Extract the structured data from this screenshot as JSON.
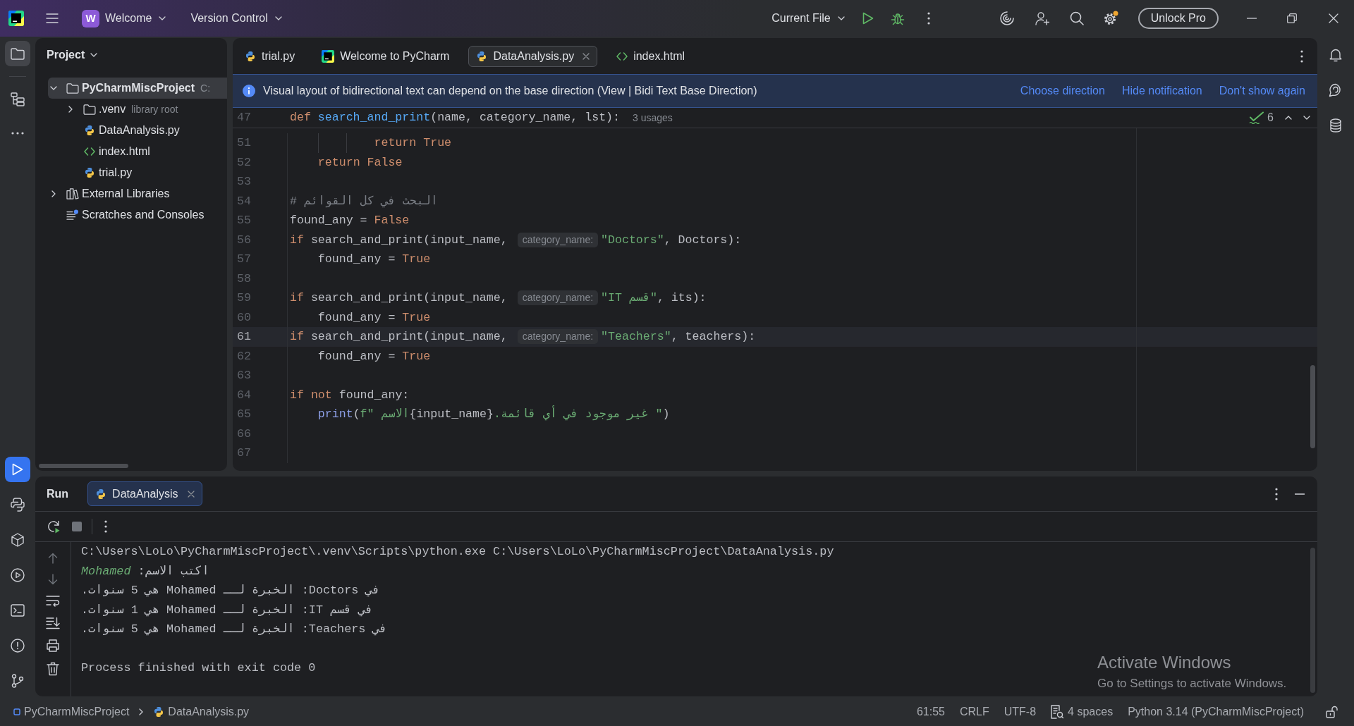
{
  "title_bar": {
    "project_badge": "W",
    "project": "Welcome",
    "vcs_menu": "Version Control",
    "run_config": "Current File",
    "unlock_button": "Unlock Pro"
  },
  "tool_strip": {
    "top": [
      {
        "selected": true
      },
      {
        "selected": false
      },
      {
        "selected": false
      }
    ],
    "bottom": [
      {
        "selected": true
      },
      {
        "selected": false
      },
      {
        "selected": false
      },
      {
        "selected": false
      },
      {
        "selected": false
      },
      {
        "selected": false
      },
      {
        "selected": false
      }
    ]
  },
  "project_panel": {
    "title": "Project",
    "tree": [
      {
        "label": "PyCharmMiscProject",
        "kind": "project",
        "hint": "C:",
        "expanded": true,
        "selected": true,
        "children": [
          {
            "label": ".venv",
            "kind": "folder",
            "hint": "library root",
            "expanded": false,
            "selected": false
          },
          {
            "label": "DataAnalysis.py",
            "kind": "python",
            "selected": false
          },
          {
            "label": "index.html",
            "kind": "html",
            "selected": false
          },
          {
            "label": "trial.py",
            "kind": "python",
            "selected": false
          }
        ]
      },
      {
        "label": "External Libraries",
        "kind": "library",
        "expanded": false,
        "selected": false
      },
      {
        "label": "Scratches and Consoles",
        "kind": "scratches",
        "selected": false
      }
    ]
  },
  "editor": {
    "tabs": [
      {
        "label": "trial.py",
        "kind": "python",
        "selected": false
      },
      {
        "label": "Welcome to PyCharm",
        "kind": "welcome",
        "selected": false
      },
      {
        "label": "DataAnalysis.py",
        "kind": "python",
        "selected": true
      },
      {
        "label": "index.html",
        "kind": "html",
        "selected": false
      }
    ],
    "notification": {
      "message": "Visual layout of bidirectional text can depend on the base direction (View | Bidi Text Base Direction)",
      "actions": [
        "Choose direction",
        "Hide notification",
        "Don't show again"
      ]
    },
    "sticky_line": {
      "number": "47",
      "tokens": [
        {
          "kind": "keyword",
          "text": "def"
        },
        {
          "kind": "function",
          "text": " search_and_print"
        },
        {
          "kind": "plain",
          "text": "(name, category_name, lst):"
        }
      ],
      "usages": "3 usages"
    },
    "problems": "6",
    "lines": [
      {
        "number": "51",
        "current": false,
        "parts": [
          {
            "kind": "code",
            "tokens": [
              {
                "kind": "keyword",
                "text": "            return True"
              }
            ]
          }
        ]
      },
      {
        "number": "52",
        "current": false,
        "parts": [
          {
            "kind": "code",
            "tokens": [
              {
                "kind": "keyword",
                "text": "    return False"
              }
            ]
          }
        ]
      },
      {
        "number": "53",
        "current": false
      },
      {
        "number": "54",
        "current": false,
        "parts": [
          {
            "kind": "code",
            "tokens": [
              {
                "kind": "comment",
                "text": "# "
              },
              {
                "kind": "comment",
                "text": "البحث في كل القوائم"
              }
            ]
          }
        ]
      },
      {
        "number": "55",
        "current": false,
        "parts": [
          {
            "kind": "code",
            "tokens": [
              {
                "kind": "plain",
                "text": "found_any = "
              },
              {
                "kind": "keyword",
                "text": "False"
              }
            ]
          }
        ]
      },
      {
        "number": "56",
        "current": false,
        "parts": [
          {
            "kind": "code",
            "tokens": [
              {
                "kind": "keyword",
                "text": "if"
              },
              {
                "kind": "plain",
                "text": " search_and_print(input_name, "
              }
            ]
          },
          {
            "kind": "hint",
            "text": "category_name:"
          },
          {
            "kind": "code",
            "tokens": [
              {
                "kind": "string",
                "text": "\"Doctors\""
              },
              {
                "kind": "plain",
                "text": ", Doctors):"
              }
            ]
          }
        ]
      },
      {
        "number": "57",
        "current": false,
        "parts": [
          {
            "kind": "code",
            "tokens": [
              {
                "kind": "plain",
                "text": "    found_any = "
              },
              {
                "kind": "keyword",
                "text": "True"
              }
            ]
          }
        ]
      },
      {
        "number": "58",
        "current": false
      },
      {
        "number": "59",
        "current": false,
        "parts": [
          {
            "kind": "code",
            "tokens": [
              {
                "kind": "keyword",
                "text": "if"
              },
              {
                "kind": "plain",
                "text": " search_and_print(input_name, "
              }
            ]
          },
          {
            "kind": "hint",
            "text": "category_name:"
          },
          {
            "kind": "code",
            "tokens": [
              {
                "kind": "string",
                "text": "\""
              },
              {
                "kind": "string",
                "text": "قسم IT"
              },
              {
                "kind": "string",
                "text": "\""
              },
              {
                "kind": "plain",
                "text": ", its):"
              }
            ]
          }
        ]
      },
      {
        "number": "60",
        "current": false,
        "parts": [
          {
            "kind": "code",
            "tokens": [
              {
                "kind": "plain",
                "text": "    found_any = "
              },
              {
                "kind": "keyword",
                "text": "True"
              }
            ]
          }
        ]
      },
      {
        "number": "61",
        "current": true,
        "parts": [
          {
            "kind": "code",
            "tokens": [
              {
                "kind": "keyword",
                "text": "if"
              },
              {
                "kind": "plain",
                "text": " search_and_print(input_name, "
              }
            ]
          },
          {
            "kind": "hint",
            "text": "category_name:"
          },
          {
            "kind": "code",
            "tokens": [
              {
                "kind": "string",
                "text": "\"Teachers\""
              },
              {
                "kind": "plain",
                "text": ", teachers):"
              }
            ]
          }
        ]
      },
      {
        "number": "62",
        "current": false,
        "parts": [
          {
            "kind": "code",
            "tokens": [
              {
                "kind": "plain",
                "text": "    found_any = "
              },
              {
                "kind": "keyword",
                "text": "True"
              }
            ]
          }
        ]
      },
      {
        "number": "63",
        "current": false
      },
      {
        "number": "64",
        "current": false,
        "parts": [
          {
            "kind": "code",
            "tokens": [
              {
                "kind": "keyword",
                "text": "if"
              },
              {
                "kind": "keyword",
                "text": " not"
              },
              {
                "kind": "plain",
                "text": " found_any:"
              }
            ]
          }
        ]
      },
      {
        "number": "65",
        "current": false,
        "parts": [
          {
            "kind": "code",
            "tokens": [
              {
                "kind": "builtin",
                "text": "    print"
              },
              {
                "kind": "plain",
                "text": "("
              },
              {
                "kind": "string",
                "text": "f\""
              },
              {
                "kind": "string",
                "text": "الاسم "
              },
              {
                "kind": "plain",
                "text": "{input_name}"
              },
              {
                "kind": "string",
                "text": " غير موجود في أي قائمة."
              },
              {
                "kind": "string",
                "text": "\""
              },
              {
                "kind": "plain",
                "text": ")"
              }
            ]
          }
        ]
      },
      {
        "number": "66",
        "current": false
      },
      {
        "number": "67",
        "current": false
      }
    ]
  },
  "run_panel": {
    "title": "Run",
    "tabs": [
      {
        "label": "DataAnalysis",
        "selected": true
      }
    ],
    "console": [
      {
        "kind": "command",
        "text": "C:\\Users\\LoLo\\PyCharmMiscProject\\.venv\\Scripts\\python.exe C:\\Users\\LoLo\\PyCharmMiscProject\\DataAnalysis.py"
      },
      {
        "kind": "prompt",
        "text": "اكتب الاسم: ",
        "input": "Mohamed"
      },
      {
        "kind": "output",
        "text": "في Doctors: الخبرة لــ Mohamed هي 5 سنوات."
      },
      {
        "kind": "output",
        "text": "في قسم IT: الخبرة لــ Mohamed هي 1 سنوات."
      },
      {
        "kind": "output",
        "text": "في Teachers: الخبرة لــ Mohamed هي 5 سنوات."
      },
      {
        "kind": "exit",
        "text": "Process finished with exit code 0"
      }
    ]
  },
  "status_bar": {
    "breadcrumbs": [
      {
        "label": "PyCharmMiscProject",
        "kind": "module"
      },
      {
        "label": "DataAnalysis.py",
        "kind": "python"
      }
    ],
    "position": "61:55",
    "line_separator": "CRLF",
    "encoding": "UTF-8",
    "indent": "4 spaces",
    "interpreter": "Python 3.14 (PyCharmMiscProject)"
  },
  "os_notice": {
    "title": "Activate Windows",
    "message": "Go to Settings to activate Windows."
  }
}
